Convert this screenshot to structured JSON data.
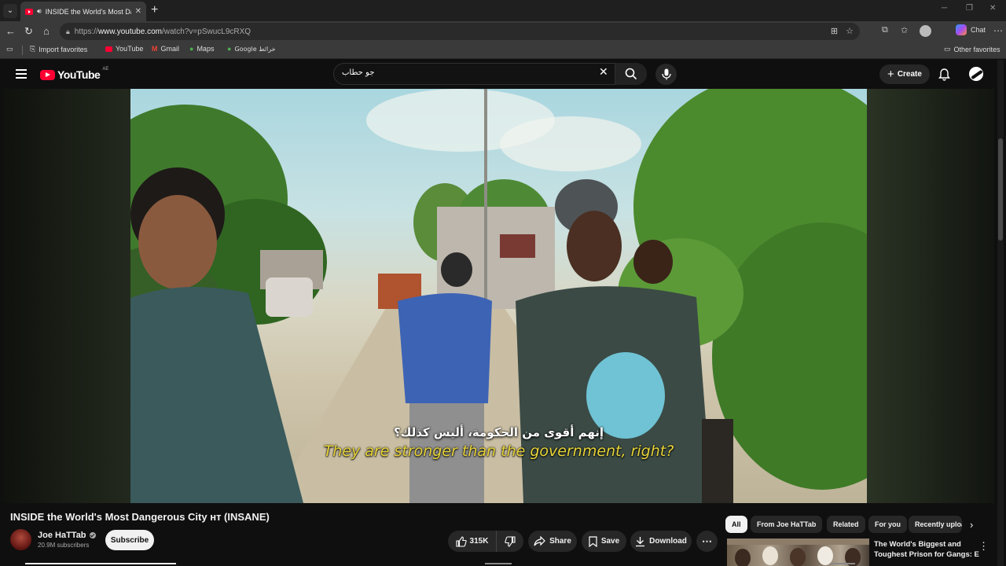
{
  "browser": {
    "tab_title": "INSIDE the World's Most Dangerous City",
    "url_prefix": "https://",
    "url_host": "www.youtube.com",
    "url_path": "/watch?v=pSwucL9cRXQ",
    "chat_label": "Chat",
    "bookmarks": {
      "import": "Import favorites",
      "youtube": "YouTube",
      "gmail": "Gmail",
      "maps": "Maps",
      "google_maps": "Google خرائط",
      "other": "Other favorites"
    }
  },
  "youtube": {
    "logo_text": "YouTube",
    "country_code": "AE",
    "search_value": "جو حطاب",
    "create_label": "Create"
  },
  "video": {
    "subtitle_ar": "إنهم أقوى من الحكومة، أليس كذلك؟",
    "subtitle_en": "They are stronger than the government, right?",
    "title": "INSIDE the World's Most Dangerous City ʜт (INSANE)",
    "channel_name": "Joe HaTTab",
    "subscribers": "20.9M subscribers",
    "subscribe_label": "Subscribe",
    "likes": "315K",
    "share_label": "Share",
    "save_label": "Save",
    "download_label": "Download"
  },
  "chips": [
    "All",
    "From Joe HaTTab",
    "Related",
    "For you",
    "Recently uploaded"
  ],
  "recommended": {
    "title_line1": "The World's Biggest and",
    "title_line2": "Toughest Prison for Gangs: E..."
  },
  "colors": {
    "youtube_red": "#ff0033",
    "subtitle_yellow": "#e8d53a",
    "background": "#0f0f0f"
  }
}
